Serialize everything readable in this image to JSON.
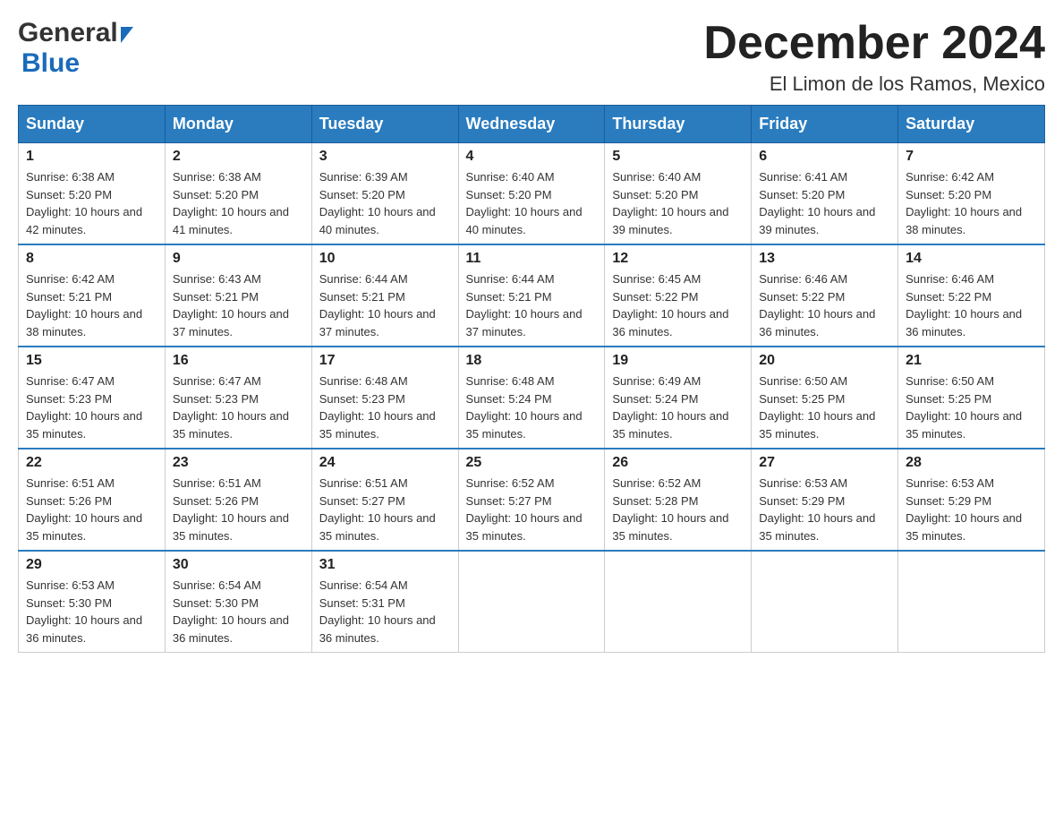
{
  "header": {
    "logo_general": "General",
    "logo_blue": "Blue",
    "month_title": "December 2024",
    "location": "El Limon de los Ramos, Mexico"
  },
  "days_of_week": [
    "Sunday",
    "Monday",
    "Tuesday",
    "Wednesday",
    "Thursday",
    "Friday",
    "Saturday"
  ],
  "weeks": [
    [
      {
        "day": "1",
        "sunrise": "6:38 AM",
        "sunset": "5:20 PM",
        "daylight": "10 hours and 42 minutes."
      },
      {
        "day": "2",
        "sunrise": "6:38 AM",
        "sunset": "5:20 PM",
        "daylight": "10 hours and 41 minutes."
      },
      {
        "day": "3",
        "sunrise": "6:39 AM",
        "sunset": "5:20 PM",
        "daylight": "10 hours and 40 minutes."
      },
      {
        "day": "4",
        "sunrise": "6:40 AM",
        "sunset": "5:20 PM",
        "daylight": "10 hours and 40 minutes."
      },
      {
        "day": "5",
        "sunrise": "6:40 AM",
        "sunset": "5:20 PM",
        "daylight": "10 hours and 39 minutes."
      },
      {
        "day": "6",
        "sunrise": "6:41 AM",
        "sunset": "5:20 PM",
        "daylight": "10 hours and 39 minutes."
      },
      {
        "day": "7",
        "sunrise": "6:42 AM",
        "sunset": "5:20 PM",
        "daylight": "10 hours and 38 minutes."
      }
    ],
    [
      {
        "day": "8",
        "sunrise": "6:42 AM",
        "sunset": "5:21 PM",
        "daylight": "10 hours and 38 minutes."
      },
      {
        "day": "9",
        "sunrise": "6:43 AM",
        "sunset": "5:21 PM",
        "daylight": "10 hours and 37 minutes."
      },
      {
        "day": "10",
        "sunrise": "6:44 AM",
        "sunset": "5:21 PM",
        "daylight": "10 hours and 37 minutes."
      },
      {
        "day": "11",
        "sunrise": "6:44 AM",
        "sunset": "5:21 PM",
        "daylight": "10 hours and 37 minutes."
      },
      {
        "day": "12",
        "sunrise": "6:45 AM",
        "sunset": "5:22 PM",
        "daylight": "10 hours and 36 minutes."
      },
      {
        "day": "13",
        "sunrise": "6:46 AM",
        "sunset": "5:22 PM",
        "daylight": "10 hours and 36 minutes."
      },
      {
        "day": "14",
        "sunrise": "6:46 AM",
        "sunset": "5:22 PM",
        "daylight": "10 hours and 36 minutes."
      }
    ],
    [
      {
        "day": "15",
        "sunrise": "6:47 AM",
        "sunset": "5:23 PM",
        "daylight": "10 hours and 35 minutes."
      },
      {
        "day": "16",
        "sunrise": "6:47 AM",
        "sunset": "5:23 PM",
        "daylight": "10 hours and 35 minutes."
      },
      {
        "day": "17",
        "sunrise": "6:48 AM",
        "sunset": "5:23 PM",
        "daylight": "10 hours and 35 minutes."
      },
      {
        "day": "18",
        "sunrise": "6:48 AM",
        "sunset": "5:24 PM",
        "daylight": "10 hours and 35 minutes."
      },
      {
        "day": "19",
        "sunrise": "6:49 AM",
        "sunset": "5:24 PM",
        "daylight": "10 hours and 35 minutes."
      },
      {
        "day": "20",
        "sunrise": "6:50 AM",
        "sunset": "5:25 PM",
        "daylight": "10 hours and 35 minutes."
      },
      {
        "day": "21",
        "sunrise": "6:50 AM",
        "sunset": "5:25 PM",
        "daylight": "10 hours and 35 minutes."
      }
    ],
    [
      {
        "day": "22",
        "sunrise": "6:51 AM",
        "sunset": "5:26 PM",
        "daylight": "10 hours and 35 minutes."
      },
      {
        "day": "23",
        "sunrise": "6:51 AM",
        "sunset": "5:26 PM",
        "daylight": "10 hours and 35 minutes."
      },
      {
        "day": "24",
        "sunrise": "6:51 AM",
        "sunset": "5:27 PM",
        "daylight": "10 hours and 35 minutes."
      },
      {
        "day": "25",
        "sunrise": "6:52 AM",
        "sunset": "5:27 PM",
        "daylight": "10 hours and 35 minutes."
      },
      {
        "day": "26",
        "sunrise": "6:52 AM",
        "sunset": "5:28 PM",
        "daylight": "10 hours and 35 minutes."
      },
      {
        "day": "27",
        "sunrise": "6:53 AM",
        "sunset": "5:29 PM",
        "daylight": "10 hours and 35 minutes."
      },
      {
        "day": "28",
        "sunrise": "6:53 AM",
        "sunset": "5:29 PM",
        "daylight": "10 hours and 35 minutes."
      }
    ],
    [
      {
        "day": "29",
        "sunrise": "6:53 AM",
        "sunset": "5:30 PM",
        "daylight": "10 hours and 36 minutes."
      },
      {
        "day": "30",
        "sunrise": "6:54 AM",
        "sunset": "5:30 PM",
        "daylight": "10 hours and 36 minutes."
      },
      {
        "day": "31",
        "sunrise": "6:54 AM",
        "sunset": "5:31 PM",
        "daylight": "10 hours and 36 minutes."
      },
      null,
      null,
      null,
      null
    ]
  ],
  "labels": {
    "sunrise_prefix": "Sunrise: ",
    "sunset_prefix": "Sunset: ",
    "daylight_prefix": "Daylight: "
  }
}
